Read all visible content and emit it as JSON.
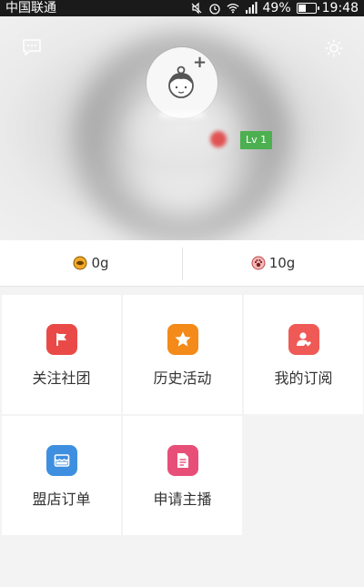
{
  "status_bar": {
    "carrier": "中国联通",
    "battery_percent": "49%",
    "time": "19:48",
    "icons": [
      "mute-icon",
      "alarm-icon",
      "wifi-icon",
      "signal-icon",
      "battery-icon"
    ]
  },
  "profile": {
    "level": "Lv 1"
  },
  "currency": {
    "coins": "0g",
    "points": "10g"
  },
  "menu": {
    "items": [
      {
        "label": "关注社团",
        "icon": "flag-icon",
        "color": "#ea4a47"
      },
      {
        "label": "历史活动",
        "icon": "star-icon",
        "color": "#f38a1a"
      },
      {
        "label": "我的订阅",
        "icon": "user-heart-icon",
        "color": "#ef5a56"
      },
      {
        "label": "盟店订单",
        "icon": "shop-icon",
        "color": "#3f8fe0"
      },
      {
        "label": "申请主播",
        "icon": "document-icon",
        "color": "#e84f78"
      }
    ]
  }
}
